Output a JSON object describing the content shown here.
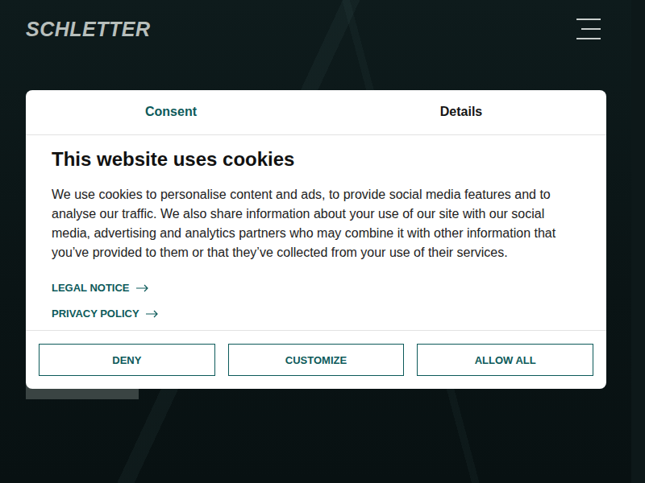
{
  "header": {
    "logo": "SCHLETTER"
  },
  "cookie_dialog": {
    "tabs": [
      {
        "label": "Consent",
        "selected": true
      },
      {
        "label": "Details",
        "selected": false
      }
    ],
    "title": "This website uses cookies",
    "body": "We use cookies to personalise content and ads, to provide social media features and to analyse our traffic. We also share information about your use of our site with our social media, advertising and analytics partners who may combine it with other information that you’ve provided to them or that they’ve collected from your use of their services.",
    "links": [
      "LEGAL NOTICE",
      "PRIVACY POLICY"
    ],
    "buttons": [
      "DENY",
      "CUSTOMIZE",
      "ALLOW ALL"
    ]
  }
}
